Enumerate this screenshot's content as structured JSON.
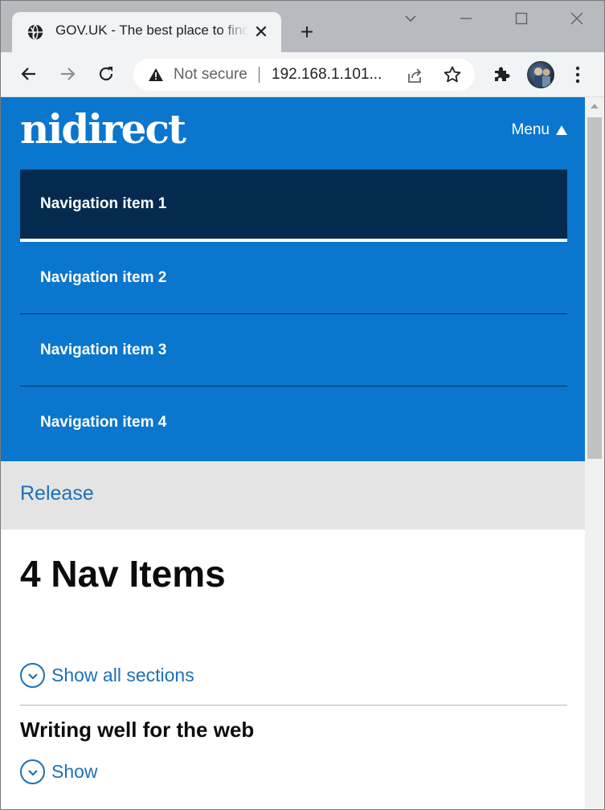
{
  "browser": {
    "tab_title": "GOV.UK - The best place to find government services and information",
    "tab_close": "✕",
    "new_tab": "+",
    "security_label": "Not secure",
    "url": "192.168.1.101..."
  },
  "site": {
    "logo": "nidirect",
    "menu_label": "Menu",
    "nav_items": [
      {
        "label": "Navigation item 1"
      },
      {
        "label": "Navigation item 2"
      },
      {
        "label": "Navigation item 3"
      },
      {
        "label": "Navigation item 4"
      }
    ],
    "breadcrumb": "Release"
  },
  "main": {
    "title": "4 Nav Items",
    "show_all_label": "Show all sections",
    "section_heading": "Writing well for the web",
    "section_show_label": "Show"
  },
  "colors": {
    "header_blue": "#0a76cd",
    "nav_active": "#042b4f",
    "link_blue": "#1d70b8",
    "band_grey": "#e4e4e4"
  }
}
